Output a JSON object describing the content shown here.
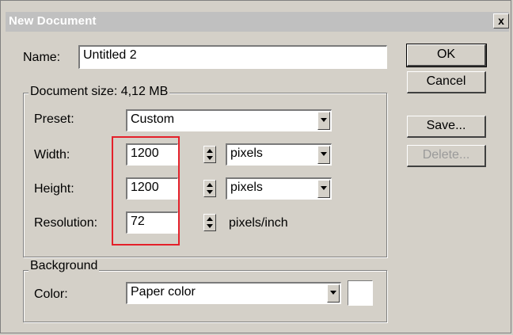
{
  "window": {
    "title": "New Document",
    "close_glyph": "x"
  },
  "name": {
    "label": "Name:",
    "value": "Untitled 2"
  },
  "document_size": {
    "legend": "Document size: 4,12 MB",
    "preset": {
      "label": "Preset:",
      "value": "Custom"
    },
    "width": {
      "label": "Width:",
      "value": "1200",
      "unit": "pixels"
    },
    "height": {
      "label": "Height:",
      "value": "1200",
      "unit": "pixels"
    },
    "resolution": {
      "label": "Resolution:",
      "value": "72",
      "unit": "pixels/inch"
    }
  },
  "background": {
    "legend": "Background",
    "color": {
      "label": "Color:",
      "value": "Paper color",
      "swatch": "#ffffff"
    }
  },
  "buttons": {
    "ok": "OK",
    "cancel": "Cancel",
    "save": "Save...",
    "delete": "Delete..."
  },
  "colors": {
    "dialog_bg": "#d4d0c8",
    "title_bg": "#c0c0c0",
    "highlight": "#e4202a"
  }
}
